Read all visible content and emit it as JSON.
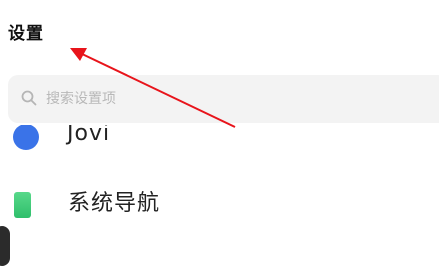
{
  "header": {
    "title": "设置"
  },
  "search": {
    "placeholder": "搜索设置项",
    "icon": "search-icon"
  },
  "list": {
    "items": [
      {
        "label": "Jovi",
        "icon": "jovi-icon",
        "color": "#3a73e8"
      },
      {
        "label": "系统导航",
        "icon": "system-navigation-icon",
        "color": "#2fbf6b"
      }
    ]
  },
  "annotation": {
    "color": "#e8141b"
  }
}
